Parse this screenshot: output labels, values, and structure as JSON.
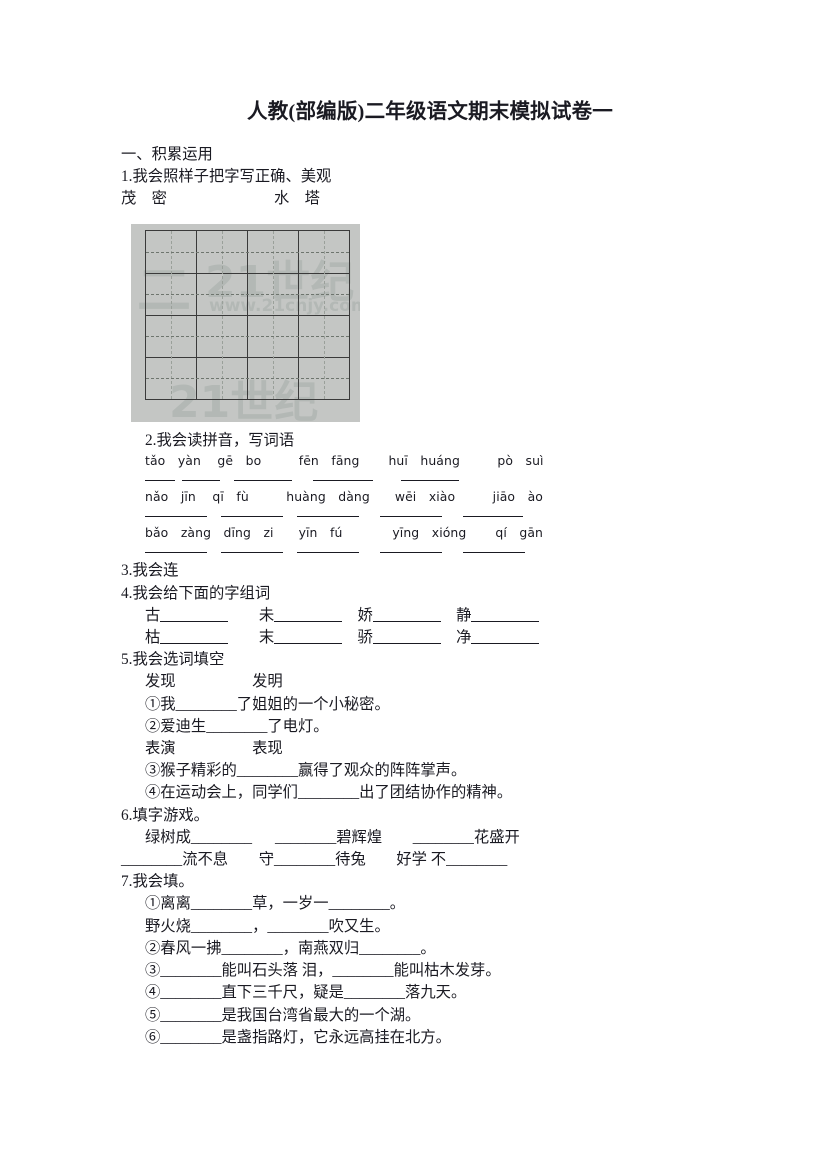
{
  "document": {
    "title": "人教(部编版)二年级语文期末模拟试卷一",
    "section_heading": "一、积累运用"
  },
  "q1": {
    "prompt": "1.我会照样子把字写正确、美观",
    "examples": "茂　密　　　　　　　水　塔",
    "grid": {
      "rows": 4,
      "cols": 4,
      "watermark_1": "二",
      "watermark_2": "21世纪",
      "watermark_3": "www.21cnjy.com",
      "watermark_4": "21世纪"
    }
  },
  "q2": {
    "prompt": "2.我会读拼音，写词语",
    "rows": [
      "tǎo　yàn　 gē　bo　　　fēn　fāng　　 huī　huáng　　　pò　suì",
      "nǎo　jīn　 qī　fù　　　huàng　dàng　　wēi　xiào　　　jiāo　ào",
      "bǎo　zàng　dīng　zi　　yīn　fú　　　　yīng　xióng　　 qí　gān"
    ]
  },
  "q3": {
    "prompt": "3.我会连"
  },
  "q4": {
    "prompt": "4.我会给下面的字组词",
    "row1": [
      "古",
      "未",
      "娇",
      "静"
    ],
    "row2": [
      "枯",
      "末",
      "骄",
      "净"
    ]
  },
  "q5": {
    "prompt": "5.我会选词填空",
    "choices_1": "发现　　　　　发明",
    "items_1": [
      "①我________了姐姐的一个小秘密。",
      "②爱迪生________了电灯。"
    ],
    "choices_2": "表演　　　　　表现",
    "items_2": [
      "③猴子精彩的________赢得了观众的阵阵掌声。",
      "④在运动会上，同学们________出了团结协作的精神。"
    ]
  },
  "q6": {
    "prompt": "6.填字游戏。",
    "row1": [
      "绿树成________",
      "________碧辉煌",
      "________花盛开"
    ],
    "row2": [
      "________流不息",
      "守________待兔",
      "好学 不________"
    ]
  },
  "q7": {
    "prompt": "7.我会填。",
    "items": [
      "①离离________草，一岁一________。",
      "野火烧________，________吹又生。",
      "②春风一拂________，南燕双归________。",
      "③________能叫石头落 泪，________能叫枯木发芽。",
      "④________直下三千尺，疑是________落九天。",
      "⑤________是我国台湾省最大的一个湖。",
      "⑥________是盏指路灯，它永远高挂在北方。"
    ]
  }
}
